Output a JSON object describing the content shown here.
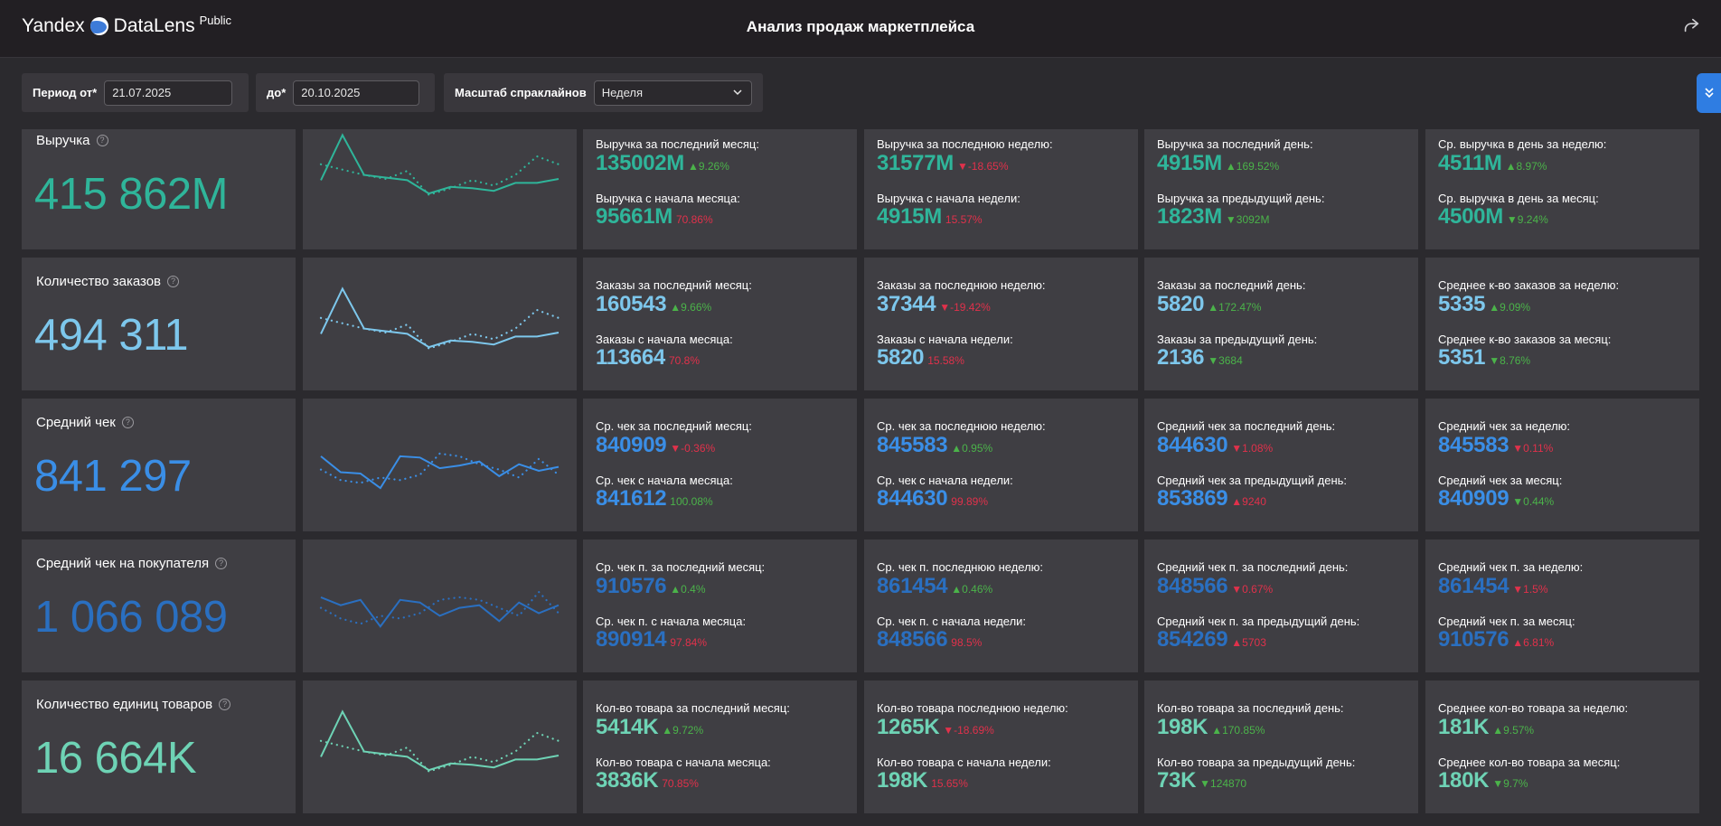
{
  "header": {
    "logo_yandex": "Yandex",
    "logo_datalens": "DataLens",
    "logo_public": "Public",
    "title": "Анализ продаж маркетплейса"
  },
  "filters": {
    "from_label": "Период от*",
    "from_value": "21.07.2025",
    "to_label": "до*",
    "to_value": "20.10.2025",
    "scale_label": "Масштаб спраклайнов",
    "scale_value": "Неделя"
  },
  "icons": {
    "share": "share-icon",
    "help": "question-circle-icon",
    "chevron": "chevron-down-icon",
    "expand": "chevrons-down-icon"
  },
  "colors": {
    "green": "#2fb59a",
    "light_blue": "#7dc7ec",
    "blue": "#3a8ee6",
    "dark_blue": "#2a6fc0",
    "mint": "#6ed3b5",
    "up": "#4bb34a",
    "down": "#e0314b"
  },
  "rows": [
    {
      "label": "Выручка",
      "value": "415 862M",
      "color": "#2fb59a",
      "sparkline": {
        "current": [
          48,
          82,
          52,
          50,
          48,
          38,
          43,
          42,
          40,
          46,
          46,
          49
        ],
        "previous": [
          60,
          56,
          52,
          49,
          55,
          37,
          42,
          48,
          44,
          52,
          66,
          60
        ]
      },
      "metrics": [
        [
          {
            "label": "Выручка за последний месяц:",
            "value": "135002M",
            "delta": "▲9.26%",
            "dir": "up"
          },
          {
            "label": "Выручка с начала месяца:",
            "value": "95661M",
            "delta": "70.86%",
            "dir": "down"
          }
        ],
        [
          {
            "label": "Выручка за последнюю неделю:",
            "value": "31577M",
            "delta": "▼-18.65%",
            "dir": "down"
          },
          {
            "label": "Выручка с начала недели:",
            "value": "4915M",
            "delta": "15.57%",
            "dir": "down"
          }
        ],
        [
          {
            "label": "Выручка за последний день:",
            "value": "4915M",
            "delta": "▲169.52%",
            "dir": "up"
          },
          {
            "label": "Выручка за предыдущий день:",
            "value": "1823M",
            "delta": "▼3092M",
            "dir": "up"
          }
        ],
        [
          {
            "label": "Ср. выручка в день за неделю:",
            "value": "4511M",
            "delta": "▲8.97%",
            "dir": "up"
          },
          {
            "label": "Ср. выручка в день за месяц:",
            "value": "4500M",
            "delta": "▼9.24%",
            "dir": "up"
          }
        ]
      ]
    },
    {
      "label": "Количество заказов",
      "value": "494 311",
      "color": "#7dc7ec",
      "sparkline": {
        "current": [
          48,
          82,
          52,
          50,
          48,
          38,
          43,
          42,
          40,
          46,
          46,
          49
        ],
        "previous": [
          60,
          56,
          52,
          49,
          55,
          37,
          42,
          48,
          44,
          52,
          66,
          60
        ]
      },
      "metrics": [
        [
          {
            "label": "Заказы за последний месяц:",
            "value": "160543",
            "delta": "▲9.66%",
            "dir": "up"
          },
          {
            "label": "Заказы с начала месяца:",
            "value": "113664",
            "delta": "70.8%",
            "dir": "down"
          }
        ],
        [
          {
            "label": "Заказы за последнюю неделю:",
            "value": "37344",
            "delta": "▼-19.42%",
            "dir": "down"
          },
          {
            "label": "Заказы с начала недели:",
            "value": "5820",
            "delta": "15.58%",
            "dir": "down"
          }
        ],
        [
          {
            "label": "Заказы за последний день:",
            "value": "5820",
            "delta": "▲172.47%",
            "dir": "up"
          },
          {
            "label": "Заказы за предыдущий день:",
            "value": "2136",
            "delta": "▼3684",
            "dir": "up"
          }
        ],
        [
          {
            "label": "Среднее к-во заказов за неделю:",
            "value": "5335",
            "delta": "▲9.09%",
            "dir": "up"
          },
          {
            "label": "Среднее к-во заказов за месяц:",
            "value": "5351",
            "delta": "▼8.76%",
            "dir": "up"
          }
        ]
      ]
    },
    {
      "label": "Средний чек",
      "value": "841 297",
      "color": "#3a8ee6",
      "sparkline": {
        "current": [
          62,
          50,
          49,
          38,
          62,
          61,
          53,
          55,
          58,
          47,
          56,
          51,
          54
        ],
        "previous": [
          52,
          44,
          42,
          46,
          44,
          48,
          64,
          62,
          56,
          52,
          46,
          60,
          48
        ]
      },
      "metrics": [
        [
          {
            "label": "Ср. чек за последний месяц:",
            "value": "840909",
            "delta": "▼-0.36%",
            "dir": "down"
          },
          {
            "label": "Ср. чек с начала месяца:",
            "value": "841612",
            "delta": "100.08%",
            "dir": "up"
          }
        ],
        [
          {
            "label": "Ср. чек за последнюю неделю:",
            "value": "845583",
            "delta": "▲0.95%",
            "dir": "up"
          },
          {
            "label": "Ср. чек с начала недели:",
            "value": "844630",
            "delta": "99.89%",
            "dir": "down"
          }
        ],
        [
          {
            "label": "Средний чек за последний день:",
            "value": "844630",
            "delta": "▼1.08%",
            "dir": "down"
          },
          {
            "label": "Средний чек за предыдущий день:",
            "value": "853869",
            "delta": "▲9240",
            "dir": "down"
          }
        ],
        [
          {
            "label": "Средний чек за неделю:",
            "value": "845583",
            "delta": "▼0.11%",
            "dir": "down"
          },
          {
            "label": "Средний чек за месяц:",
            "value": "840909",
            "delta": "▼0.44%",
            "dir": "up"
          }
        ]
      ]
    },
    {
      "label": "Средний чек на покупателя",
      "value": "1 066 089",
      "color": "#2a6fc0",
      "sparkline": {
        "current": [
          62,
          56,
          60,
          40,
          60,
          58,
          48,
          54,
          56,
          44,
          58,
          50,
          56
        ],
        "previous": [
          54,
          46,
          42,
          48,
          46,
          50,
          60,
          62,
          60,
          54,
          48,
          66,
          50
        ]
      },
      "metrics": [
        [
          {
            "label": "Ср. чек п. за последний месяц:",
            "value": "910576",
            "delta": "▲0.4%",
            "dir": "up"
          },
          {
            "label": "Ср. чек п. с начала месяца:",
            "value": "890914",
            "delta": "97.84%",
            "dir": "down"
          }
        ],
        [
          {
            "label": "Ср. чек п. последнюю неделю:",
            "value": "861454",
            "delta": "▲0.46%",
            "dir": "up"
          },
          {
            "label": "Ср. чек п. с начала недели:",
            "value": "848566",
            "delta": "98.5%",
            "dir": "down"
          }
        ],
        [
          {
            "label": "Средний чек п. за последний день:",
            "value": "848566",
            "delta": "▼0.67%",
            "dir": "down"
          },
          {
            "label": "Средний чек п. за предыдущий день:",
            "value": "854269",
            "delta": "▲5703",
            "dir": "down"
          }
        ],
        [
          {
            "label": "Средний чек п. за неделю:",
            "value": "861454",
            "delta": "▼1.5%",
            "dir": "down"
          },
          {
            "label": "Средний чек п. за месяц:",
            "value": "910576",
            "delta": "▲6.81%",
            "dir": "down"
          }
        ]
      ]
    },
    {
      "label": "Количество единиц товаров",
      "value": "16 664K",
      "color": "#6ed3b5",
      "sparkline": {
        "current": [
          48,
          82,
          52,
          50,
          48,
          38,
          43,
          42,
          40,
          46,
          46,
          49
        ],
        "previous": [
          60,
          56,
          52,
          49,
          55,
          37,
          42,
          48,
          44,
          52,
          66,
          60
        ]
      },
      "metrics": [
        [
          {
            "label": "Кол-во товара за последний месяц:",
            "value": "5414K",
            "delta": "▲9.72%",
            "dir": "up"
          },
          {
            "label": "Кол-во товара с начала месяца:",
            "value": "3836K",
            "delta": "70.85%",
            "dir": "down"
          }
        ],
        [
          {
            "label": "Кол-во товара последнюю неделю:",
            "value": "1265K",
            "delta": "▼-18.69%",
            "dir": "down"
          },
          {
            "label": "Кол-во товара с начала недели:",
            "value": "198K",
            "delta": "15.65%",
            "dir": "down"
          }
        ],
        [
          {
            "label": "Кол-во товара за последний день:",
            "value": "198K",
            "delta": "▲170.85%",
            "dir": "up"
          },
          {
            "label": "Кол-во товара за предыдущий день:",
            "value": "73K",
            "delta": "▼124870",
            "dir": "up"
          }
        ],
        [
          {
            "label": "Среднее кол-во товара за неделю:",
            "value": "181K",
            "delta": "▲9.57%",
            "dir": "up"
          },
          {
            "label": "Среднее кол-во товара за месяц:",
            "value": "180K",
            "delta": "▼9.7%",
            "dir": "up"
          }
        ]
      ]
    }
  ]
}
